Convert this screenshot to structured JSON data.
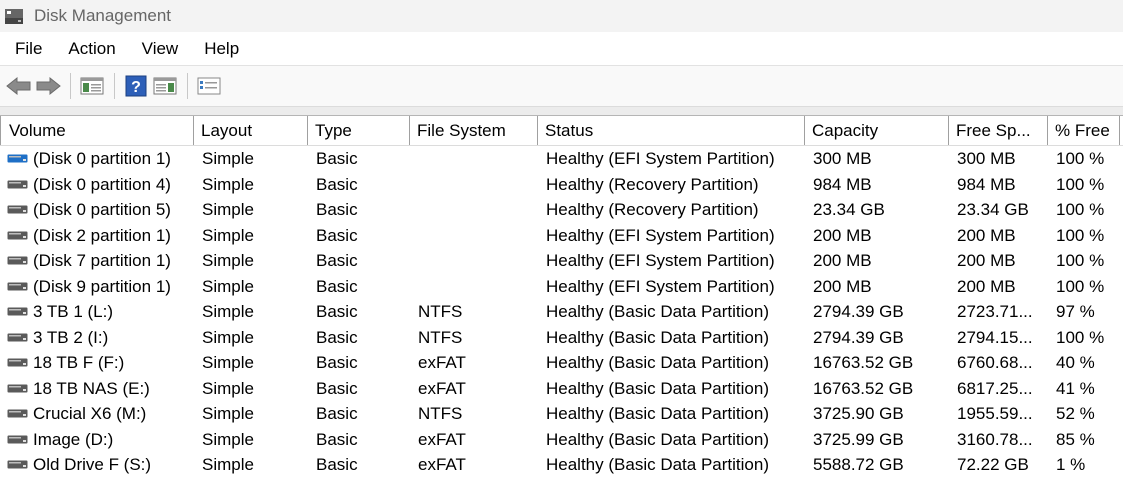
{
  "window": {
    "title": "Disk Management"
  },
  "menu": [
    "File",
    "Action",
    "View",
    "Help"
  ],
  "toolbar": {
    "buttons": [
      "back-icon",
      "forward-icon",
      "console-tree-icon",
      "help-icon",
      "action-pane-icon",
      "properties-icon"
    ]
  },
  "columns": [
    "Volume",
    "Layout",
    "Type",
    "File System",
    "Status",
    "Capacity",
    "Free Sp...",
    "% Free"
  ],
  "colors": {
    "drive_icon": "#5a5a5a",
    "selected_drive_icon": "#1e6fc6"
  },
  "rows": [
    {
      "volume": "(Disk 0 partition 1)",
      "layout": "Simple",
      "type": "Basic",
      "fs": "",
      "status": "Healthy (EFI System Partition)",
      "capacity": "300 MB",
      "free": "300 MB",
      "pct": "100 %"
    },
    {
      "volume": "(Disk 0 partition 4)",
      "layout": "Simple",
      "type": "Basic",
      "fs": "",
      "status": "Healthy (Recovery Partition)",
      "capacity": "984 MB",
      "free": "984 MB",
      "pct": "100 %"
    },
    {
      "volume": "(Disk 0 partition 5)",
      "layout": "Simple",
      "type": "Basic",
      "fs": "",
      "status": "Healthy (Recovery Partition)",
      "capacity": "23.34 GB",
      "free": "23.34 GB",
      "pct": "100 %"
    },
    {
      "volume": "(Disk 2 partition 1)",
      "layout": "Simple",
      "type": "Basic",
      "fs": "",
      "status": "Healthy (EFI System Partition)",
      "capacity": "200 MB",
      "free": "200 MB",
      "pct": "100 %"
    },
    {
      "volume": "(Disk 7 partition 1)",
      "layout": "Simple",
      "type": "Basic",
      "fs": "",
      "status": "Healthy (EFI System Partition)",
      "capacity": "200 MB",
      "free": "200 MB",
      "pct": "100 %"
    },
    {
      "volume": "(Disk 9 partition 1)",
      "layout": "Simple",
      "type": "Basic",
      "fs": "",
      "status": "Healthy (EFI System Partition)",
      "capacity": "200 MB",
      "free": "200 MB",
      "pct": "100 %"
    },
    {
      "volume": "3 TB 1 (L:)",
      "layout": "Simple",
      "type": "Basic",
      "fs": "NTFS",
      "status": "Healthy (Basic Data Partition)",
      "capacity": "2794.39 GB",
      "free": "2723.71...",
      "pct": "97 %"
    },
    {
      "volume": "3 TB 2 (I:)",
      "layout": "Simple",
      "type": "Basic",
      "fs": "NTFS",
      "status": "Healthy (Basic Data Partition)",
      "capacity": "2794.39 GB",
      "free": "2794.15...",
      "pct": "100 %"
    },
    {
      "volume": "18 TB F (F:)",
      "layout": "Simple",
      "type": "Basic",
      "fs": "exFAT",
      "status": "Healthy (Basic Data Partition)",
      "capacity": "16763.52 GB",
      "free": "6760.68...",
      "pct": "40 %"
    },
    {
      "volume": "18 TB NAS (E:)",
      "layout": "Simple",
      "type": "Basic",
      "fs": "exFAT",
      "status": "Healthy (Basic Data Partition)",
      "capacity": "16763.52 GB",
      "free": "6817.25...",
      "pct": "41 %"
    },
    {
      "volume": "Crucial X6 (M:)",
      "layout": "Simple",
      "type": "Basic",
      "fs": "NTFS",
      "status": "Healthy (Basic Data Partition)",
      "capacity": "3725.90 GB",
      "free": "1955.59...",
      "pct": "52 %"
    },
    {
      "volume": "Image (D:)",
      "layout": "Simple",
      "type": "Basic",
      "fs": "exFAT",
      "status": "Healthy (Basic Data Partition)",
      "capacity": "3725.99 GB",
      "free": "3160.78...",
      "pct": "85 %"
    },
    {
      "volume": "Old Drive F (S:)",
      "layout": "Simple",
      "type": "Basic",
      "fs": "exFAT",
      "status": "Healthy (Basic Data Partition)",
      "capacity": "5588.72 GB",
      "free": "72.22 GB",
      "pct": "1 %"
    }
  ]
}
